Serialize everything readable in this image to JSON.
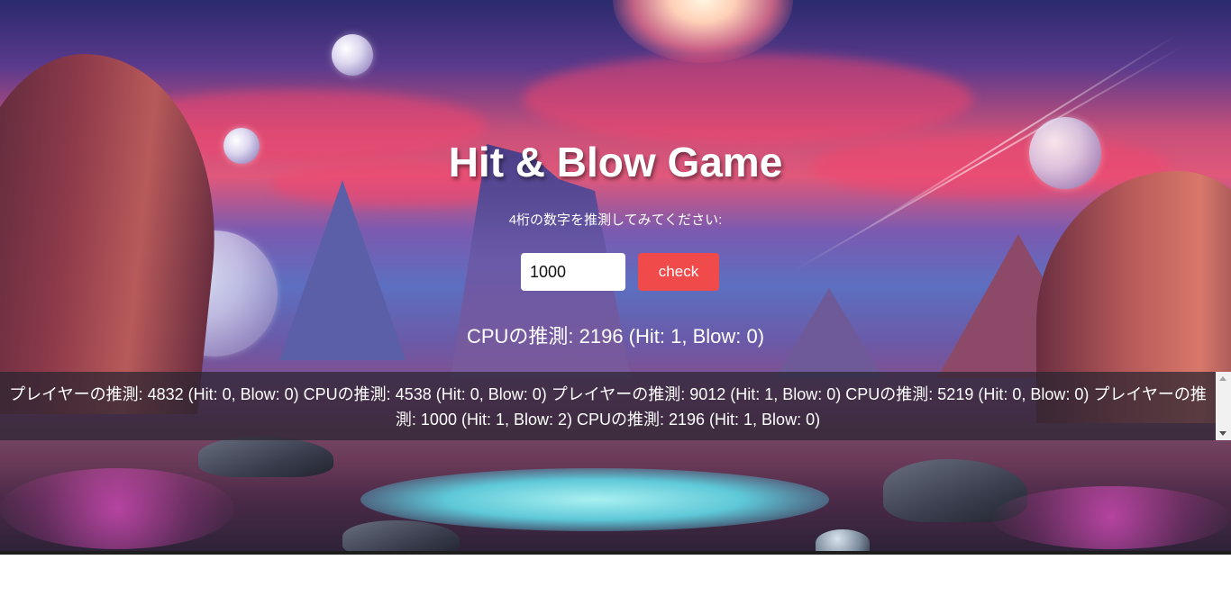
{
  "game": {
    "title": "Hit & Blow Game",
    "instruction": "4桁の数字を推測してみてください:",
    "input_value": "1000",
    "check_label": "check",
    "cpu_guess_text": "CPUの推測: 2196 (Hit: 1, Blow: 0)"
  },
  "history": {
    "text": "プレイヤーの推測: 4832 (Hit: 0, Blow: 0) CPUの推測: 4538 (Hit: 0, Blow: 0) プレイヤーの推測: 9012 (Hit: 1, Blow: 0) CPUの推測: 5219 (Hit: 0, Blow: 0) プレイヤーの推測: 1000 (Hit: 1, Blow: 2) CPUの推測: 2196 (Hit: 1, Blow: 0)"
  },
  "colors": {
    "check_button": "#f04a4a",
    "text": "#ffffff",
    "history_panel": "rgba(40, 36, 48, 0.72)"
  }
}
